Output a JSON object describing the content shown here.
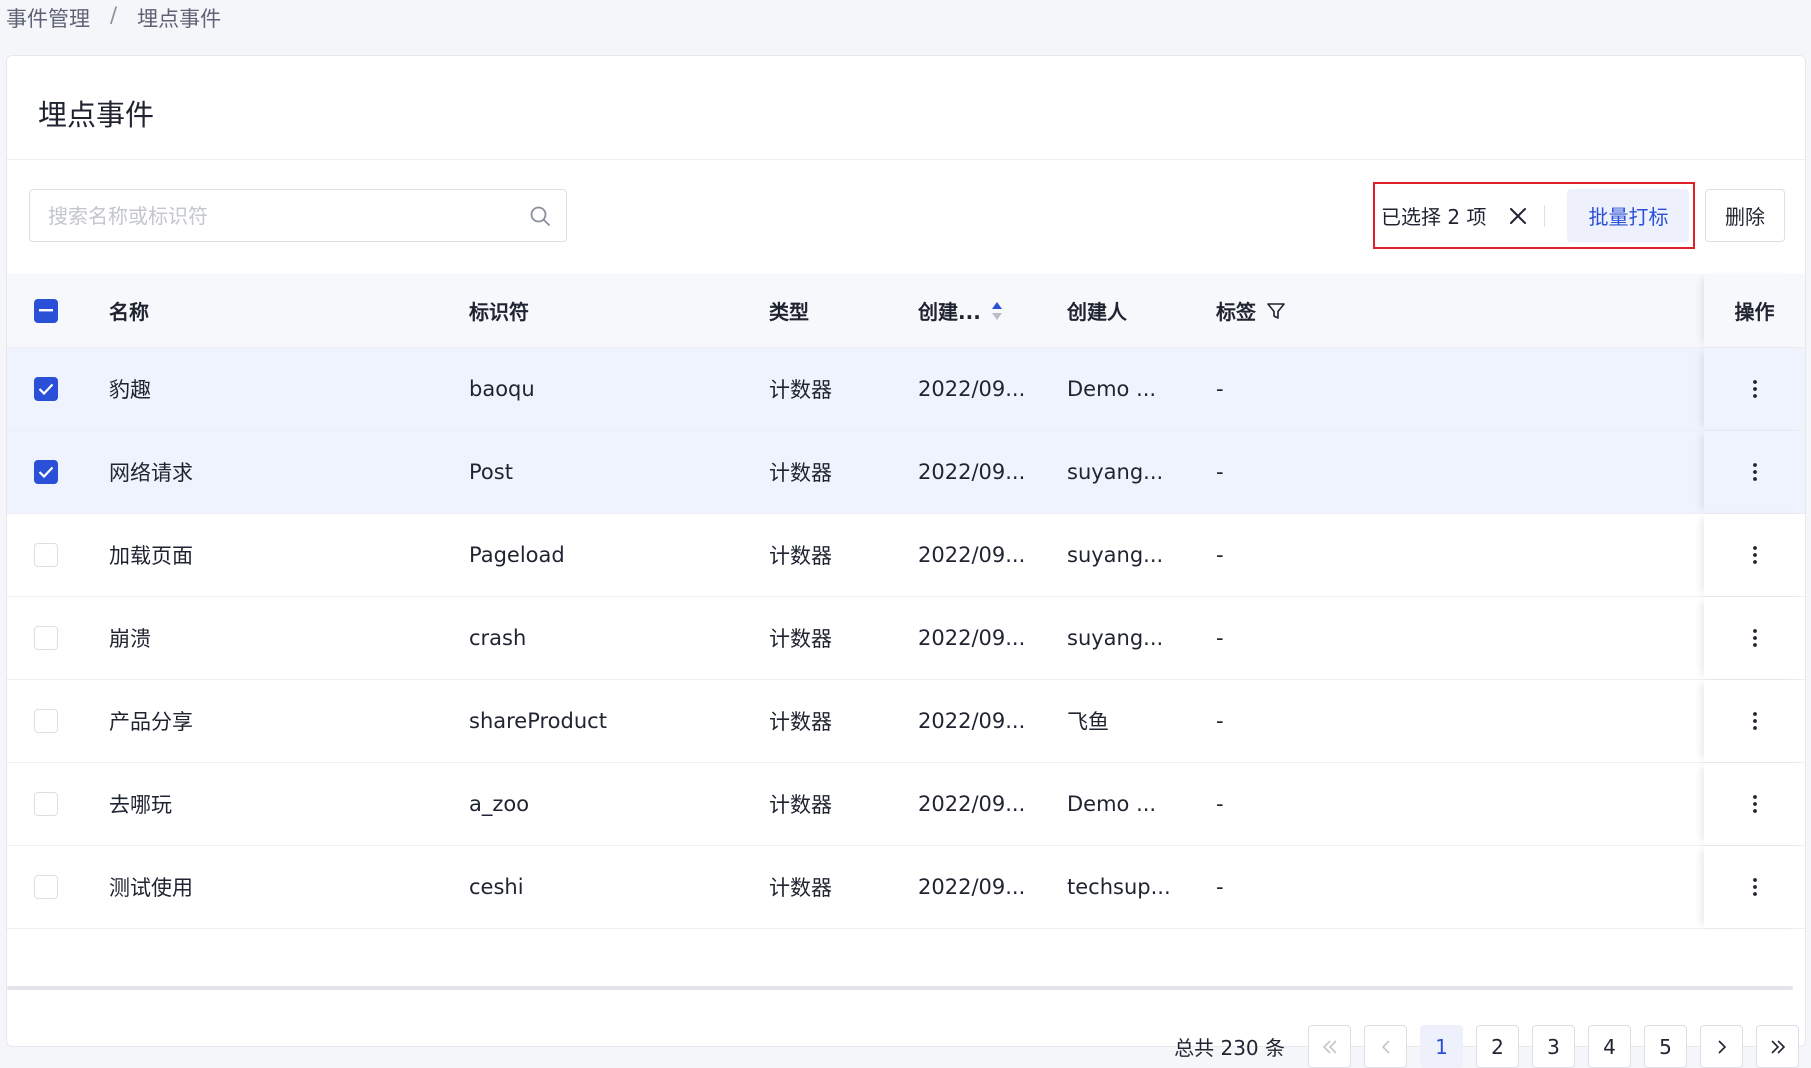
{
  "breadcrumb": {
    "parent": "事件管理",
    "separator": "/",
    "current": "埋点事件"
  },
  "page_title": "埋点事件",
  "search": {
    "placeholder": "搜索名称或标识符",
    "value": ""
  },
  "selection": {
    "text": "已选择 2 项",
    "batch_label": "批量打标"
  },
  "delete_label": "删除",
  "columns": {
    "name": "名称",
    "identifier": "标识符",
    "type": "类型",
    "created_time": "创建...",
    "creator": "创建人",
    "tags": "标签",
    "actions": "操作"
  },
  "rows": [
    {
      "checked": true,
      "name": "豹趣",
      "identifier": "baoqu",
      "type": "计数器",
      "created_time": "2022/09...",
      "creator": "Demo ...",
      "tags": "-"
    },
    {
      "checked": true,
      "name": "网络请求",
      "identifier": "Post",
      "type": "计数器",
      "created_time": "2022/09...",
      "creator": "suyang...",
      "tags": "-"
    },
    {
      "checked": false,
      "name": "加载页面",
      "identifier": "Pageload",
      "type": "计数器",
      "created_time": "2022/09...",
      "creator": "suyang...",
      "tags": "-"
    },
    {
      "checked": false,
      "name": "崩溃",
      "identifier": "crash",
      "type": "计数器",
      "created_time": "2022/09...",
      "creator": "suyang...",
      "tags": "-"
    },
    {
      "checked": false,
      "name": "产品分享",
      "identifier": "shareProduct",
      "type": "计数器",
      "created_time": "2022/09...",
      "creator": "飞鱼",
      "tags": "-"
    },
    {
      "checked": false,
      "name": "去哪玩",
      "identifier": "a_zoo",
      "type": "计数器",
      "created_time": "2022/09...",
      "creator": "Demo ...",
      "tags": "-"
    },
    {
      "checked": false,
      "name": "测试使用",
      "identifier": "ceshi",
      "type": "计数器",
      "created_time": "2022/09...",
      "creator": "techsup...",
      "tags": "-"
    }
  ],
  "pagination": {
    "total_text": "总共 230 条",
    "pages": [
      "1",
      "2",
      "3",
      "4",
      "5"
    ],
    "current": "1"
  },
  "colors": {
    "primary": "#2a50d8",
    "highlight_border": "#e0212a",
    "selected_row": "#eff3fd"
  },
  "icons": {
    "search": "search-icon",
    "clear": "close-icon",
    "sort": "sort-icon",
    "filter": "filter-icon",
    "more": "more-vertical-icon",
    "first": "double-chevron-left-icon",
    "prev": "chevron-left-icon",
    "next": "chevron-right-icon",
    "last": "double-chevron-right-icon"
  }
}
